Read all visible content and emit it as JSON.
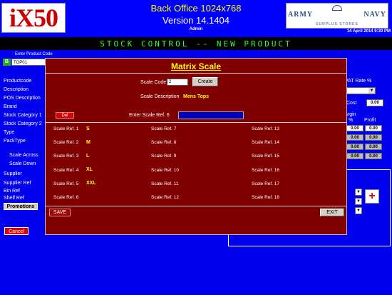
{
  "header": {
    "logo_text": "iX50",
    "title": "Back Office 1024x768",
    "version": "Version 14.1404",
    "user": "Admin",
    "brand_line1": "ARMY",
    "brand_line2": "NAVY",
    "brand_line3": "SURPLUS STORES",
    "datetime": "14 April 2014 9:30 PM"
  },
  "banner": {
    "text": "STOCK CONTROL -- NEW PRODUCT"
  },
  "form": {
    "product_code_label": "Enter Product Code",
    "b_icon": "B",
    "product_code_value": "TOP01",
    "labels": [
      "Productcode",
      "Description",
      "POS Description",
      "Brand",
      "Stock Category 1",
      "Stock Category 2",
      "Type",
      "PackType",
      "Scale Across",
      "Scale Down",
      "Supplier",
      "Supplier Ref",
      "Bin Ref",
      "Shelf Ref"
    ],
    "vat_label": "VAT Rate %",
    "cost_label": "Cost",
    "cost_value": "0.00",
    "margin_label": "argin",
    "margin_pct_label": "%",
    "profit_label": "Profit",
    "price_rows": [
      {
        "pct": "0.00",
        "profit": "0.00"
      },
      {
        "pct": "0.00",
        "profit": "0.00"
      },
      {
        "pct": "0.00",
        "profit": "0.00"
      },
      {
        "pct": "0.00",
        "profit": "0.00"
      }
    ],
    "promotions_button": "Promotions",
    "cancel_button": "Cancel"
  },
  "modal": {
    "title": "Matrix Scale",
    "scale_code_label": "Scale Code",
    "scale_code_value": "2",
    "create_button": "Create",
    "scale_description_label": "Scale Description",
    "scale_description_value": "Mens Tops",
    "del_button": "Del",
    "enter_ref_label": "Enter Scale Ref. 6",
    "refs_col1": [
      {
        "label": "Scale Ref.  1",
        "value": "S"
      },
      {
        "label": "Scale Ref.  2",
        "value": "M"
      },
      {
        "label": "Scale Ref.  3",
        "value": "L"
      },
      {
        "label": "Scale Ref.  4",
        "value": "XL"
      },
      {
        "label": "Scale Ref.  5",
        "value": "XXL"
      },
      {
        "label": "Scale Ref.  6",
        "value": ""
      }
    ],
    "refs_col2": [
      {
        "label": "Scale Ref.  7"
      },
      {
        "label": "Scale Ref.  8"
      },
      {
        "label": "Scale Ref.  9"
      },
      {
        "label": "Scale Ref. 10"
      },
      {
        "label": "Scale Ref. 11"
      },
      {
        "label": "Scale Ref. 12"
      }
    ],
    "refs_col3": [
      {
        "label": "Scale Ref. 13"
      },
      {
        "label": "Scale Ref. 14"
      },
      {
        "label": "Scale Ref. 15"
      },
      {
        "label": "Scale Ref. 16"
      },
      {
        "label": "Scale Ref. 17"
      },
      {
        "label": "Scale Ref. 18"
      }
    ],
    "save_button": "SAVE",
    "exit_button": "EXIT"
  },
  "colors": {
    "background": "#0000ee",
    "modal_background": "#800000",
    "accent_yellow": "#ffff00",
    "banner_green": "#33ff33"
  }
}
